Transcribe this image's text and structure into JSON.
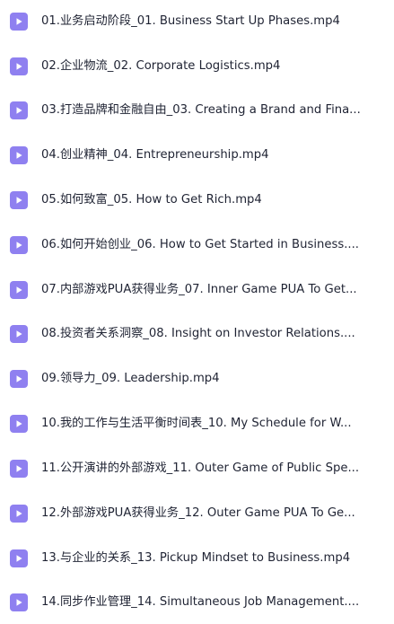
{
  "files": [
    {
      "name": "01.业务启动阶段_01. Business Start Up Phases.mp4",
      "icon": "video-file-icon"
    },
    {
      "name": "02.企业物流_02. Corporate Logistics.mp4",
      "icon": "video-file-icon"
    },
    {
      "name": "03.打造品牌和金融自由_03. Creating a Brand and Fina...",
      "icon": "video-file-icon"
    },
    {
      "name": "04.创业精神_04. Entrepreneurship.mp4",
      "icon": "video-file-icon"
    },
    {
      "name": "05.如何致富_05. How to Get Rich.mp4",
      "icon": "video-file-icon"
    },
    {
      "name": "06.如何开始创业_06. How to Get Started in Business....",
      "icon": "video-file-icon"
    },
    {
      "name": "07.内部游戏PUA获得业务_07. Inner Game PUA To Get...",
      "icon": "video-file-icon"
    },
    {
      "name": "08.投资者关系洞察_08. Insight on Investor Relations....",
      "icon": "video-file-icon"
    },
    {
      "name": "09.领导力_09. Leadership.mp4",
      "icon": "video-file-icon"
    },
    {
      "name": "10.我的工作与生活平衡时间表_10. My Schedule for W...",
      "icon": "video-file-icon"
    },
    {
      "name": "11.公开演讲的外部游戏_11. Outer Game of Public Spe...",
      "icon": "video-file-icon"
    },
    {
      "name": "12.外部游戏PUA获得业务_12. Outer Game PUA To Ge...",
      "icon": "video-file-icon"
    },
    {
      "name": "13.与企业的关系_13. Pickup Mindset to Business.mp4",
      "icon": "video-file-icon"
    },
    {
      "name": "14.同步作业管理_14. Simultaneous Job Management....",
      "icon": "video-file-icon"
    }
  ],
  "colors": {
    "icon_bg": "#8f80f0",
    "text": "#1f2333",
    "background": "#ffffff"
  }
}
